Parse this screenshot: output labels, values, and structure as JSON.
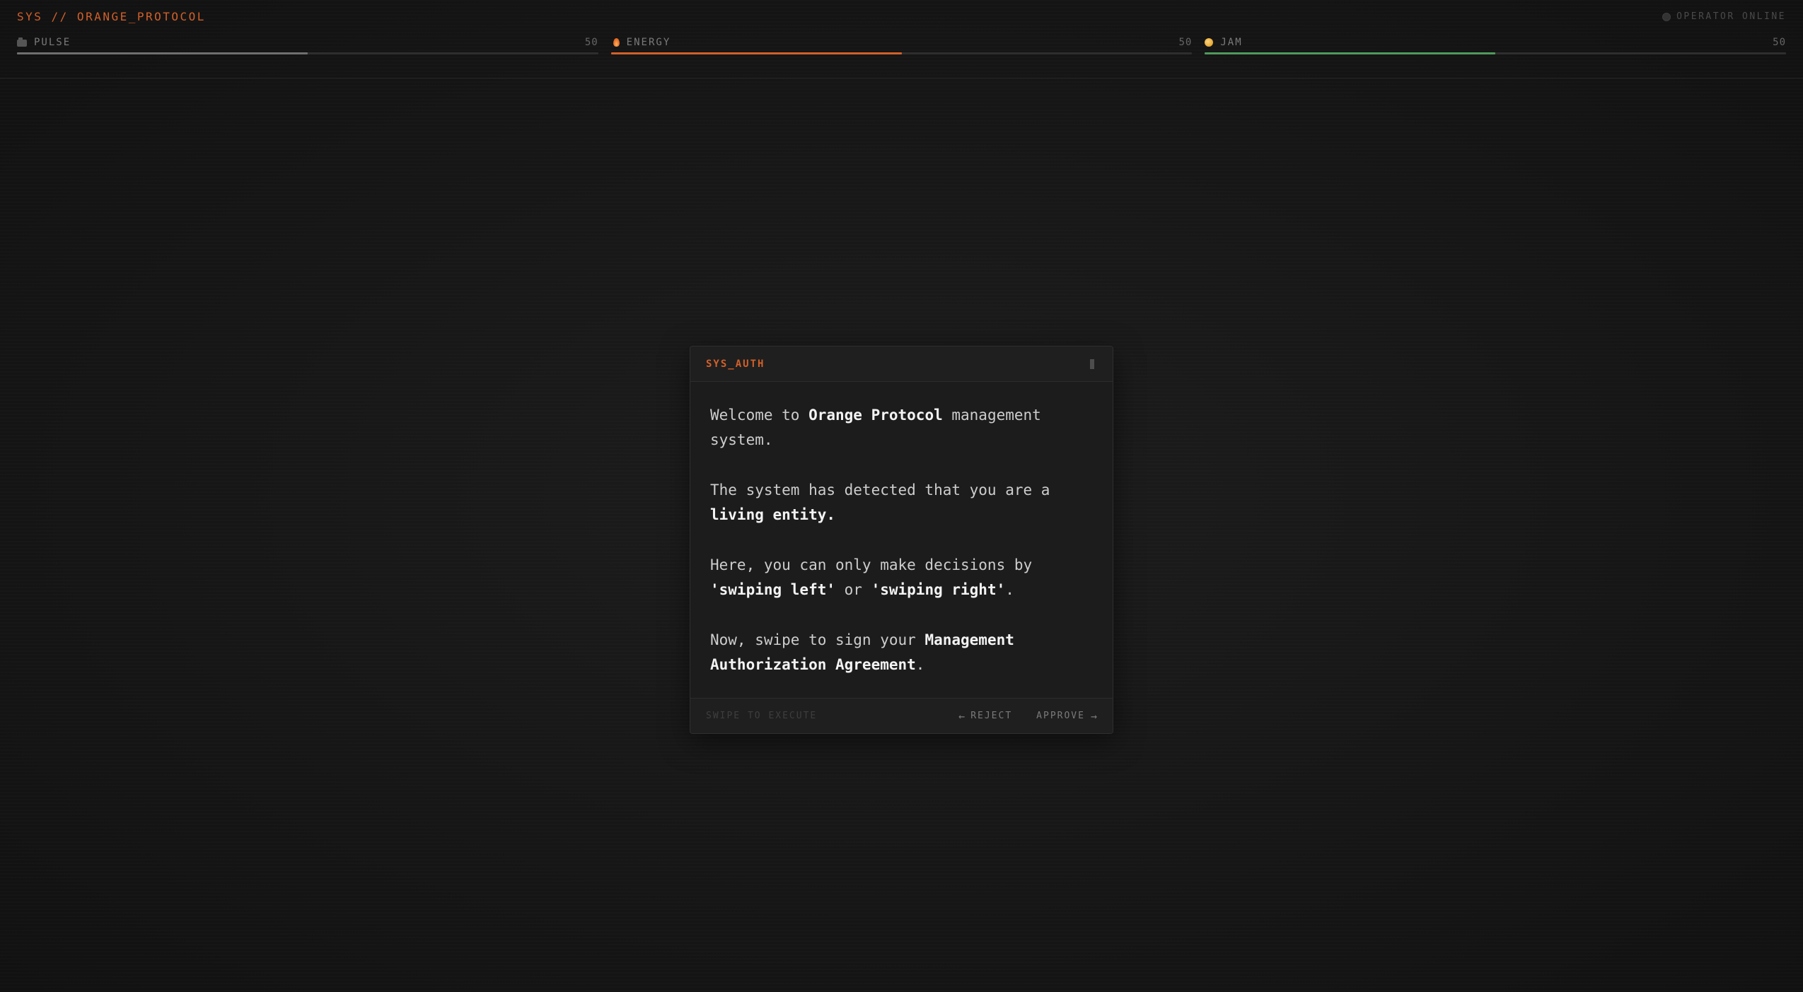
{
  "header": {
    "brand": "SYS // ORANGE_PROTOCOL",
    "operator_status": "OPERATOR ONLINE"
  },
  "stats": [
    {
      "name": "PULSE",
      "value": "50",
      "fill_percent": 50,
      "color": "#6f6f6f",
      "icon": "battery-icon"
    },
    {
      "name": "ENERGY",
      "value": "50",
      "fill_percent": 50,
      "color": "#d2602a",
      "icon": "flame-icon"
    },
    {
      "name": "JAM",
      "value": "50",
      "fill_percent": 50,
      "color": "#4f9a5c",
      "icon": "orange-icon"
    }
  ],
  "card": {
    "title": "SYS_AUTH",
    "paragraphs": [
      [
        {
          "text": "Welcome to "
        },
        {
          "text": "Orange Protocol",
          "bold": true
        },
        {
          "text": " management system."
        }
      ],
      [
        {
          "text": "The system has detected that you are a "
        },
        {
          "text": "living entity.",
          "bold": true
        }
      ],
      [
        {
          "text": "Here, you can only make decisions by "
        },
        {
          "text": "'swiping left'",
          "bold": true
        },
        {
          "text": " or "
        },
        {
          "text": "'swiping right'",
          "bold": true
        },
        {
          "text": "."
        }
      ],
      [
        {
          "text": "Now, swipe to sign your "
        },
        {
          "text": "Management Authorization Agreement",
          "bold": true
        },
        {
          "text": "."
        }
      ]
    ],
    "footer": {
      "hint": "SWIPE TO EXECUTE",
      "reject_label": "REJECT",
      "approve_label": "APPROVE",
      "reject_arrow": "←",
      "approve_arrow": "→"
    }
  },
  "colors": {
    "accent": "#d2602a",
    "background": "#141414",
    "card": "#1c1c1c"
  }
}
